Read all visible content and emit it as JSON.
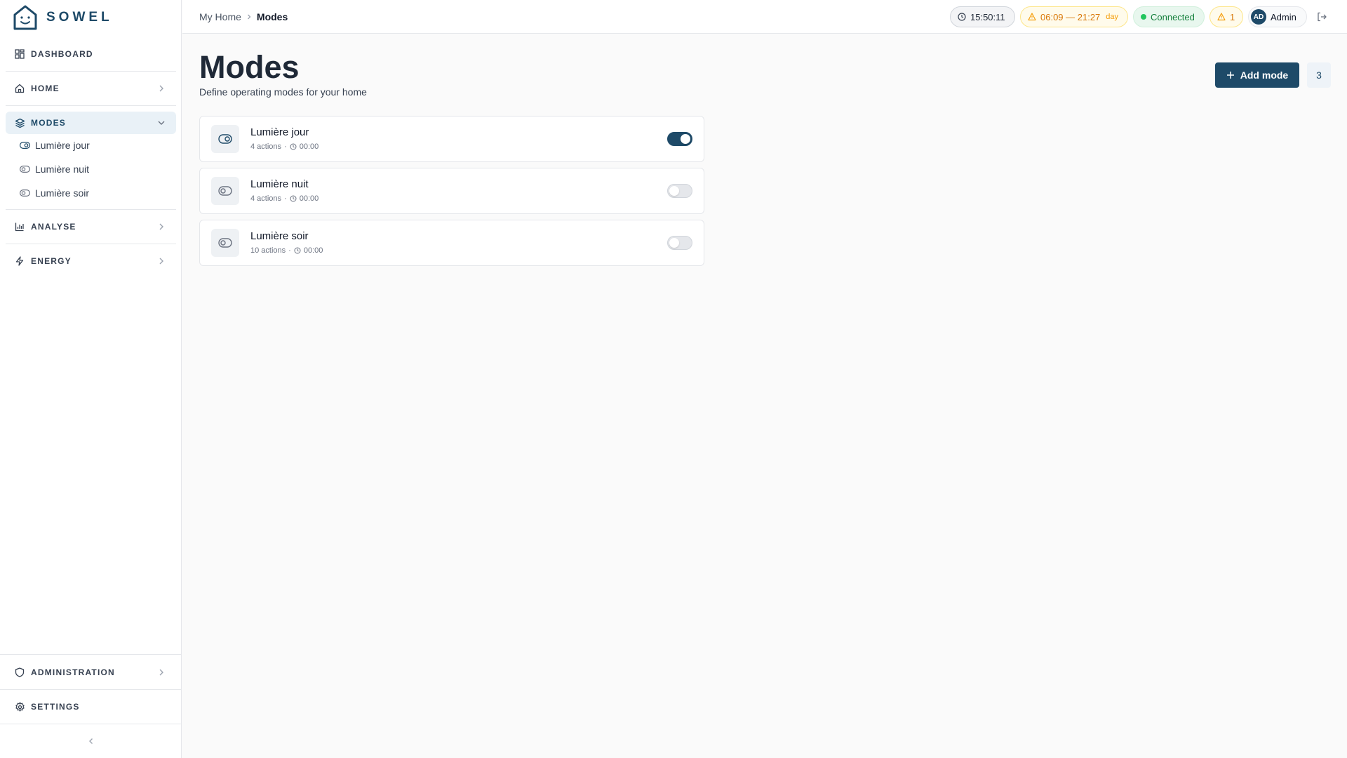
{
  "brand": {
    "name": "SOWEL"
  },
  "sidebar": {
    "dashboard": "DASHBOARD",
    "home": "HOME",
    "modes": "MODES",
    "mode_items": [
      "Lumière jour",
      "Lumière nuit",
      "Lumière soir"
    ],
    "analyse": "ANALYSE",
    "energy": "ENERGY",
    "administration": "ADMINISTRATION",
    "settings": "SETTINGS"
  },
  "topbar": {
    "breadcrumb": [
      "My Home",
      "Modes"
    ],
    "clock": "15:50:11",
    "sun_range": "06:09 — 21:27",
    "sun_tag": "day",
    "connection": "Connected",
    "alerts": "1",
    "user_initials": "AD",
    "user_name": "Admin"
  },
  "page": {
    "title": "Modes",
    "subtitle": "Define operating modes for your home",
    "add_button": "Add mode",
    "count": "3"
  },
  "modes": [
    {
      "name": "Lumière jour",
      "actions": "4 actions",
      "time": "00:00",
      "enabled": true
    },
    {
      "name": "Lumière nuit",
      "actions": "4 actions",
      "time": "00:00",
      "enabled": false
    },
    {
      "name": "Lumière soir",
      "actions": "10 actions",
      "time": "00:00",
      "enabled": false
    }
  ],
  "colors": {
    "brand": "#1e4a68",
    "active_bg": "#e9f1f7",
    "connected": "#22c55e",
    "warning": "#d97706"
  }
}
